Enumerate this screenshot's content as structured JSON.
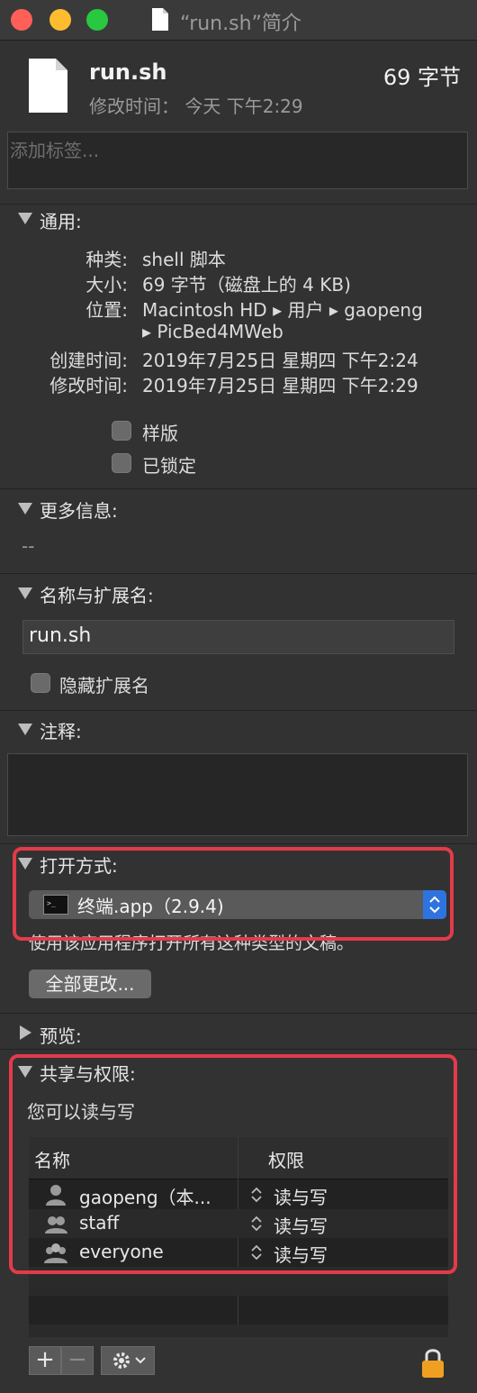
{
  "window": {
    "title": "“run.sh”简介"
  },
  "header": {
    "file_name": "run.sh",
    "file_size": "69 字节",
    "modified": "修改时间： 今天 下午2:29",
    "tags_placeholder": "添加标签..."
  },
  "general": {
    "title": "通用:",
    "rows": [
      {
        "label": "种类:",
        "value": "shell 脚本"
      },
      {
        "label": "大小:",
        "value": "69 字节（磁盘上的 4 KB)"
      },
      {
        "label": "位置:",
        "value": "Macintosh HD ▸ 用户 ▸ gaopeng"
      },
      {
        "label": "",
        "value": "▸ PicBed4MWeb"
      },
      {
        "label": "创建时间:",
        "value": "2019年7月25日 星期四 下午2:24"
      },
      {
        "label": "修改时间:",
        "value": "2019年7月25日 星期四 下午2:29"
      }
    ],
    "stationery_label": "样版",
    "locked_label": "已锁定"
  },
  "more_info": {
    "title": "更多信息:",
    "value": "--"
  },
  "name_ext": {
    "title": "名称与扩展名:",
    "field_value": "run.sh",
    "hide_ext_label": "隐藏扩展名"
  },
  "comments": {
    "title": "注释:"
  },
  "open_with": {
    "title": "打开方式:",
    "app": "终端.app（2.9.4)",
    "hint": "使用该应用程序打开所有这种类型的文稿。",
    "change_all_button": "全部更改..."
  },
  "preview": {
    "title": "预览:"
  },
  "sharing": {
    "title": "共享与权限:",
    "summary": "您可以读与写",
    "columns": [
      "名称",
      "权限"
    ],
    "rows": [
      {
        "name": "gaopeng（本...",
        "perm": "读与写",
        "icon": "single-user-icon"
      },
      {
        "name": "staff",
        "perm": "读与写",
        "icon": "group-icon"
      },
      {
        "name": "everyone",
        "perm": "读与写",
        "icon": "everyone-icon"
      }
    ],
    "add_button": "+",
    "remove_button": "−"
  },
  "colors": {
    "close": "#ff5f57",
    "minimize": "#febc2e",
    "zoom": "#28c840",
    "highlight_box": "#e23b4a",
    "popup_accent": "#2f73e0",
    "lock": "#f0a020"
  }
}
